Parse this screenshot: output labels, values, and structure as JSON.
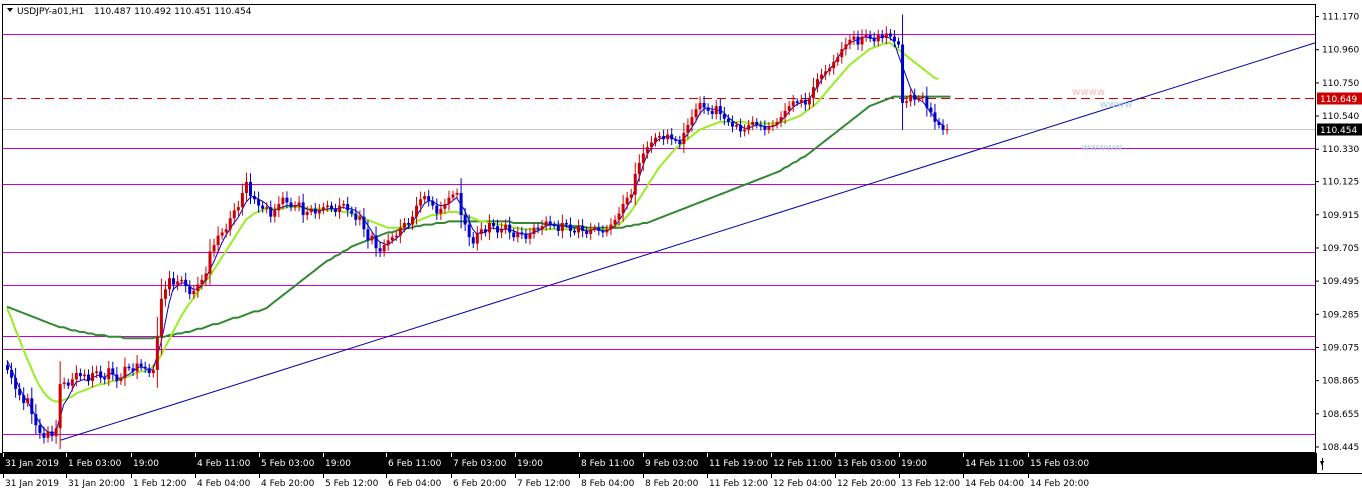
{
  "chart_data": {
    "type": "candlestick",
    "symbol": "USDJPY-a01,H1",
    "ohlc_header": "110.487 110.492 110.451 110.454",
    "colors": {
      "bull": "#cc0000",
      "bear": "#0000cc",
      "ma_fast": "#0000cc",
      "ma_mid": "#99ee22",
      "ma_slow": "#338833",
      "hline": "#cc00cc",
      "dash": "#cc0000",
      "trend": "#0000aa",
      "price_tag_bg": "#cc0000",
      "last_tag_bg": "#000000"
    },
    "ylim": [
      108.41,
      111.24
    ],
    "y_ticks": [
      "111.170",
      "110.960",
      "110.750",
      "110.540",
      "110.330",
      "110.125",
      "109.915",
      "109.705",
      "109.495",
      "109.285",
      "109.075",
      "108.865",
      "108.655",
      "108.445"
    ],
    "h_levels": [
      111.055,
      110.335,
      110.105,
      109.675,
      109.465,
      109.145,
      109.06,
      108.525
    ],
    "dash_level": 110.649,
    "dash_label": "110.649",
    "last_price": 110.454,
    "last_label": "110.454",
    "trendline": {
      "x": [
        0.044,
        1.0
      ],
      "y": [
        108.485,
        111.0
      ]
    },
    "watermarks": [
      {
        "text": "wwww",
        "color": "#f2b8b8",
        "x": 0.815,
        "y": 110.67
      },
      {
        "text": "wwww",
        "color": "#a8cde8",
        "x": 0.836,
        "y": 110.59
      },
      {
        "text": "wwwww",
        "color": "#a8cde8",
        "x": 0.822,
        "y": 110.32
      }
    ],
    "x_ticks_top": [
      "31 Jan 2019",
      "1 Feb 03:00",
      "19:00",
      "4 Feb 11:00",
      "5 Feb 03:00",
      "19:00",
      "6 Feb 11:00",
      "7 Feb 03:00",
      "19:00",
      "8 Feb 11:00",
      "9 Feb 03:00",
      "11 Feb 19:00",
      "12 Feb 11:00",
      "13 Feb 03:00",
      "19:00",
      "14 Feb 11:00",
      "15 Feb 03:00"
    ],
    "x_ticks_bottom": [
      "31 Jan 2019",
      "31 Jan 20:00",
      "1 Feb 12:00",
      "4 Feb 04:00",
      "4 Feb 20:00",
      "5 Feb 12:00",
      "6 Feb 04:00",
      "6 Feb 20:00",
      "7 Feb 12:00",
      "8 Feb 04:00",
      "8 Feb 20:00",
      "11 Feb 12:00",
      "12 Feb 04:00",
      "12 Feb 20:00",
      "13 Feb 12:00",
      "14 Feb 04:00",
      "14 Feb 20:00"
    ],
    "close": [
      108.93,
      108.88,
      108.81,
      108.77,
      108.72,
      108.75,
      108.65,
      108.58,
      108.53,
      108.5,
      108.54,
      108.51,
      108.56,
      108.84,
      108.85,
      108.83,
      108.87,
      108.91,
      108.89,
      108.9,
      108.86,
      108.91,
      108.92,
      108.88,
      108.87,
      108.94,
      108.9,
      108.86,
      108.88,
      108.95,
      108.94,
      108.92,
      108.97,
      108.95,
      108.94,
      108.91,
      108.93,
      109.14,
      109.38,
      109.44,
      109.51,
      109.47,
      109.49,
      109.5,
      109.46,
      109.41,
      109.43,
      109.47,
      109.5,
      109.54,
      109.68,
      109.72,
      109.78,
      109.8,
      109.82,
      109.89,
      109.94,
      109.96,
      110.05,
      110.12,
      110.03,
      110.01,
      109.97,
      109.95,
      109.96,
      109.9,
      109.94,
      109.98,
      110.02,
      109.99,
      109.96,
      109.97,
      109.99,
      109.91,
      109.93,
      109.95,
      109.92,
      109.94,
      109.96,
      109.97,
      109.95,
      109.93,
      109.97,
      109.98,
      109.94,
      109.92,
      109.88,
      109.9,
      109.82,
      109.75,
      109.78,
      109.7,
      109.68,
      109.72,
      109.75,
      109.77,
      109.78,
      109.83,
      109.86,
      109.85,
      109.9,
      109.97,
      110.01,
      110.03,
      110.0,
      109.97,
      109.92,
      109.95,
      109.98,
      110.02,
      110.04,
      110.05,
      109.91,
      109.85,
      109.77,
      109.73,
      109.79,
      109.82,
      109.8,
      109.86,
      109.84,
      109.8,
      109.82,
      109.85,
      109.8,
      109.77,
      109.8,
      109.79,
      109.76,
      109.79,
      109.83,
      109.82,
      109.84,
      109.87,
      109.85,
      109.84,
      109.81,
      109.86,
      109.85,
      109.81,
      109.8,
      109.84,
      109.81,
      109.79,
      109.82,
      109.83,
      109.81,
      109.8,
      109.82,
      109.85,
      109.88,
      109.92,
      109.98,
      110.02,
      110.04,
      110.17,
      110.24,
      110.3,
      110.34,
      110.37,
      110.4,
      110.41,
      110.39,
      110.42,
      110.39,
      110.38,
      110.36,
      110.43,
      110.48,
      110.53,
      110.58,
      110.62,
      110.59,
      110.57,
      110.55,
      110.6,
      110.55,
      110.52,
      110.5,
      110.47,
      110.48,
      110.44,
      110.45,
      110.48,
      110.5,
      110.48,
      110.47,
      110.45,
      110.47,
      110.48,
      110.5,
      110.53,
      110.57,
      110.6,
      110.63,
      110.62,
      110.64,
      110.61,
      110.65,
      110.72,
      110.77,
      110.8,
      110.82,
      110.84,
      110.88,
      110.91,
      110.96,
      110.99,
      111.02,
      111.04,
      110.99,
      111.04,
      111.05,
      111.03,
      111.01,
      111.05,
      111.03,
      111.06,
      111.04,
      111.01,
      110.99,
      110.62,
      110.63,
      110.67,
      110.64,
      110.65,
      110.66,
      110.59,
      110.56,
      110.5,
      110.48,
      110.45,
      110.454
    ],
    "ma_fast": [
      108.99,
      108.94,
      108.88,
      108.82,
      108.77,
      108.73,
      108.69,
      108.64,
      108.6,
      108.56,
      108.54,
      108.53,
      108.53,
      108.62,
      108.71,
      108.75,
      108.8,
      108.85,
      108.86,
      108.87,
      108.86,
      108.88,
      108.89,
      108.9,
      108.88,
      108.9,
      108.91,
      108.89,
      108.87,
      108.89,
      108.9,
      108.92,
      108.94,
      108.95,
      108.94,
      108.93,
      108.93,
      109.01,
      109.1,
      109.22,
      109.35,
      109.44,
      109.46,
      109.48,
      109.48,
      109.46,
      109.44,
      109.44,
      109.46,
      109.5,
      109.56,
      109.61,
      109.67,
      109.73,
      109.78,
      109.82,
      109.86,
      109.89,
      109.94,
      109.99,
      110.02,
      110.03,
      110.01,
      110.0,
      109.98,
      109.95,
      109.94,
      109.95,
      109.96,
      109.97,
      109.97,
      109.97,
      109.97,
      109.96,
      109.95,
      109.94,
      109.94,
      109.94,
      109.94,
      109.95,
      109.95,
      109.95,
      109.95,
      109.96,
      109.95,
      109.95,
      109.94,
      109.92,
      109.89,
      109.85,
      109.81,
      109.77,
      109.74,
      109.73,
      109.72,
      109.74,
      109.76,
      109.78,
      109.81,
      109.83,
      109.86,
      109.9,
      109.94,
      109.98,
      110.0,
      110.0,
      109.98,
      109.97,
      109.97,
      109.98,
      110.0,
      110.02,
      109.98,
      109.94,
      109.88,
      109.82,
      109.79,
      109.8,
      109.8,
      109.82,
      109.83,
      109.82,
      109.82,
      109.82,
      109.82,
      109.81,
      109.8,
      109.79,
      109.79,
      109.79,
      109.8,
      109.81,
      109.82,
      109.84,
      109.85,
      109.85,
      109.84,
      109.84,
      109.84,
      109.83,
      109.83,
      109.83,
      109.82,
      109.81,
      109.81,
      109.82,
      109.82,
      109.81,
      109.81,
      109.82,
      109.84,
      109.87,
      109.91,
      109.96,
      110.0,
      110.07,
      110.14,
      110.22,
      110.29,
      110.33,
      110.37,
      110.39,
      110.4,
      110.41,
      110.4,
      110.39,
      110.38,
      110.39,
      110.42,
      110.46,
      110.5,
      110.55,
      110.58,
      110.59,
      110.58,
      110.58,
      110.57,
      110.56,
      110.53,
      110.51,
      110.49,
      110.48,
      110.46,
      110.46,
      110.47,
      110.48,
      110.48,
      110.47,
      110.47,
      110.47,
      110.48,
      110.5,
      110.53,
      110.56,
      110.59,
      110.61,
      110.62,
      110.63,
      110.64,
      110.68,
      110.72,
      110.76,
      110.8,
      110.83,
      110.86,
      110.9,
      110.94,
      110.97,
      111.0,
      111.01,
      111.02,
      111.03,
      111.04,
      111.03,
      111.03,
      111.03,
      111.04,
      111.04,
      111.03,
      111.01,
      110.93,
      110.86,
      110.79,
      110.72,
      110.67,
      110.64,
      110.63,
      110.6,
      110.56,
      110.53,
      110.5,
      110.48
    ],
    "ma_mid": [
      109.32,
      109.26,
      109.19,
      109.13,
      109.06,
      109.0,
      108.94,
      108.88,
      108.83,
      108.79,
      108.76,
      108.74,
      108.73,
      108.73,
      108.74,
      108.75,
      108.76,
      108.78,
      108.79,
      108.8,
      108.81,
      108.82,
      108.83,
      108.84,
      108.84,
      108.85,
      108.86,
      108.86,
      108.87,
      108.88,
      108.89,
      108.9,
      108.91,
      108.92,
      108.92,
      108.93,
      108.95,
      108.98,
      109.02,
      109.07,
      109.12,
      109.17,
      109.22,
      109.27,
      109.31,
      109.35,
      109.38,
      109.42,
      109.45,
      109.49,
      109.52,
      109.56,
      109.6,
      109.64,
      109.68,
      109.72,
      109.76,
      109.8,
      109.84,
      109.88,
      109.9,
      109.92,
      109.93,
      109.94,
      109.95,
      109.95,
      109.95,
      109.95,
      109.95,
      109.96,
      109.96,
      109.96,
      109.96,
      109.96,
      109.95,
      109.95,
      109.95,
      109.95,
      109.95,
      109.94,
      109.94,
      109.94,
      109.94,
      109.93,
      109.93,
      109.92,
      109.91,
      109.9,
      109.89,
      109.88,
      109.87,
      109.86,
      109.85,
      109.84,
      109.83,
      109.83,
      109.83,
      109.83,
      109.84,
      109.85,
      109.86,
      109.87,
      109.88,
      109.89,
      109.9,
      109.91,
      109.91,
      109.92,
      109.92,
      109.93,
      109.93,
      109.93,
      109.92,
      109.91,
      109.9,
      109.89,
      109.88,
      109.87,
      109.87,
      109.86,
      109.86,
      109.85,
      109.85,
      109.84,
      109.84,
      109.83,
      109.83,
      109.82,
      109.82,
      109.82,
      109.82,
      109.82,
      109.82,
      109.82,
      109.82,
      109.82,
      109.82,
      109.82,
      109.82,
      109.82,
      109.82,
      109.82,
      109.82,
      109.82,
      109.82,
      109.82,
      109.82,
      109.82,
      109.82,
      109.83,
      109.84,
      109.85,
      109.87,
      109.9,
      109.93,
      109.97,
      110.01,
      110.05,
      110.09,
      110.13,
      110.17,
      110.21,
      110.24,
      110.27,
      110.3,
      110.33,
      110.35,
      110.37,
      110.39,
      110.41,
      110.43,
      110.45,
      110.46,
      110.47,
      110.48,
      110.49,
      110.5,
      110.5,
      110.5,
      110.5,
      110.5,
      110.5,
      110.5,
      110.49,
      110.49,
      110.49,
      110.49,
      110.49,
      110.49,
      110.49,
      110.49,
      110.5,
      110.5,
      110.51,
      110.52,
      110.53,
      110.54,
      110.56,
      110.58,
      110.6,
      110.62,
      110.65,
      110.68,
      110.71,
      110.74,
      110.77,
      110.8,
      110.83,
      110.86,
      110.88,
      110.9,
      110.92,
      110.94,
      110.96,
      110.97,
      110.98,
      110.99,
      111.0,
      111.0,
      110.98,
      110.96,
      110.94,
      110.92,
      110.9,
      110.88,
      110.86,
      110.84,
      110.82,
      110.8,
      110.78,
      110.77
    ],
    "ma_slow": [
      109.33,
      109.32,
      109.31,
      109.3,
      109.29,
      109.28,
      109.27,
      109.26,
      109.25,
      109.24,
      109.23,
      109.22,
      109.21,
      109.2,
      109.2,
      109.19,
      109.18,
      109.18,
      109.17,
      109.17,
      109.16,
      109.16,
      109.15,
      109.15,
      109.15,
      109.14,
      109.14,
      109.14,
      109.14,
      109.13,
      109.13,
      109.13,
      109.13,
      109.13,
      109.13,
      109.13,
      109.13,
      109.14,
      109.14,
      109.14,
      109.15,
      109.15,
      109.16,
      109.16,
      109.17,
      109.17,
      109.18,
      109.19,
      109.19,
      109.2,
      109.21,
      109.22,
      109.22,
      109.23,
      109.24,
      109.25,
      109.26,
      109.26,
      109.27,
      109.28,
      109.29,
      109.3,
      109.3,
      109.31,
      109.32,
      109.34,
      109.36,
      109.38,
      109.4,
      109.42,
      109.44,
      109.46,
      109.48,
      109.5,
      109.52,
      109.54,
      109.56,
      109.58,
      109.6,
      109.62,
      109.63,
      109.65,
      109.66,
      109.68,
      109.69,
      109.71,
      109.72,
      109.73,
      109.74,
      109.75,
      109.76,
      109.77,
      109.78,
      109.79,
      109.8,
      109.8,
      109.81,
      109.82,
      109.82,
      109.83,
      109.83,
      109.84,
      109.84,
      109.85,
      109.85,
      109.85,
      109.86,
      109.86,
      109.86,
      109.87,
      109.87,
      109.87,
      109.87,
      109.87,
      109.87,
      109.87,
      109.87,
      109.87,
      109.87,
      109.87,
      109.87,
      109.87,
      109.87,
      109.87,
      109.87,
      109.86,
      109.86,
      109.86,
      109.86,
      109.86,
      109.86,
      109.86,
      109.86,
      109.85,
      109.85,
      109.85,
      109.85,
      109.85,
      109.84,
      109.84,
      109.84,
      109.84,
      109.84,
      109.83,
      109.83,
      109.83,
      109.83,
      109.83,
      109.83,
      109.83,
      109.83,
      109.83,
      109.83,
      109.84,
      109.84,
      109.85,
      109.85,
      109.86,
      109.86,
      109.87,
      109.88,
      109.89,
      109.9,
      109.91,
      109.92,
      109.93,
      109.94,
      109.95,
      109.96,
      109.97,
      109.98,
      109.99,
      110.0,
      110.01,
      110.02,
      110.03,
      110.04,
      110.05,
      110.06,
      110.07,
      110.08,
      110.09,
      110.1,
      110.11,
      110.12,
      110.13,
      110.14,
      110.15,
      110.16,
      110.17,
      110.18,
      110.19,
      110.21,
      110.22,
      110.24,
      110.25,
      110.27,
      110.28,
      110.3,
      110.32,
      110.34,
      110.36,
      110.38,
      110.4,
      110.42,
      110.44,
      110.46,
      110.48,
      110.5,
      110.52,
      110.54,
      110.56,
      110.58,
      110.6,
      110.61,
      110.62,
      110.63,
      110.64,
      110.65,
      110.66,
      110.66,
      110.66,
      110.66,
      110.66,
      110.66,
      110.66,
      110.66,
      110.66,
      110.66,
      110.66,
      110.66,
      110.66,
      110.66,
      110.66
    ]
  }
}
